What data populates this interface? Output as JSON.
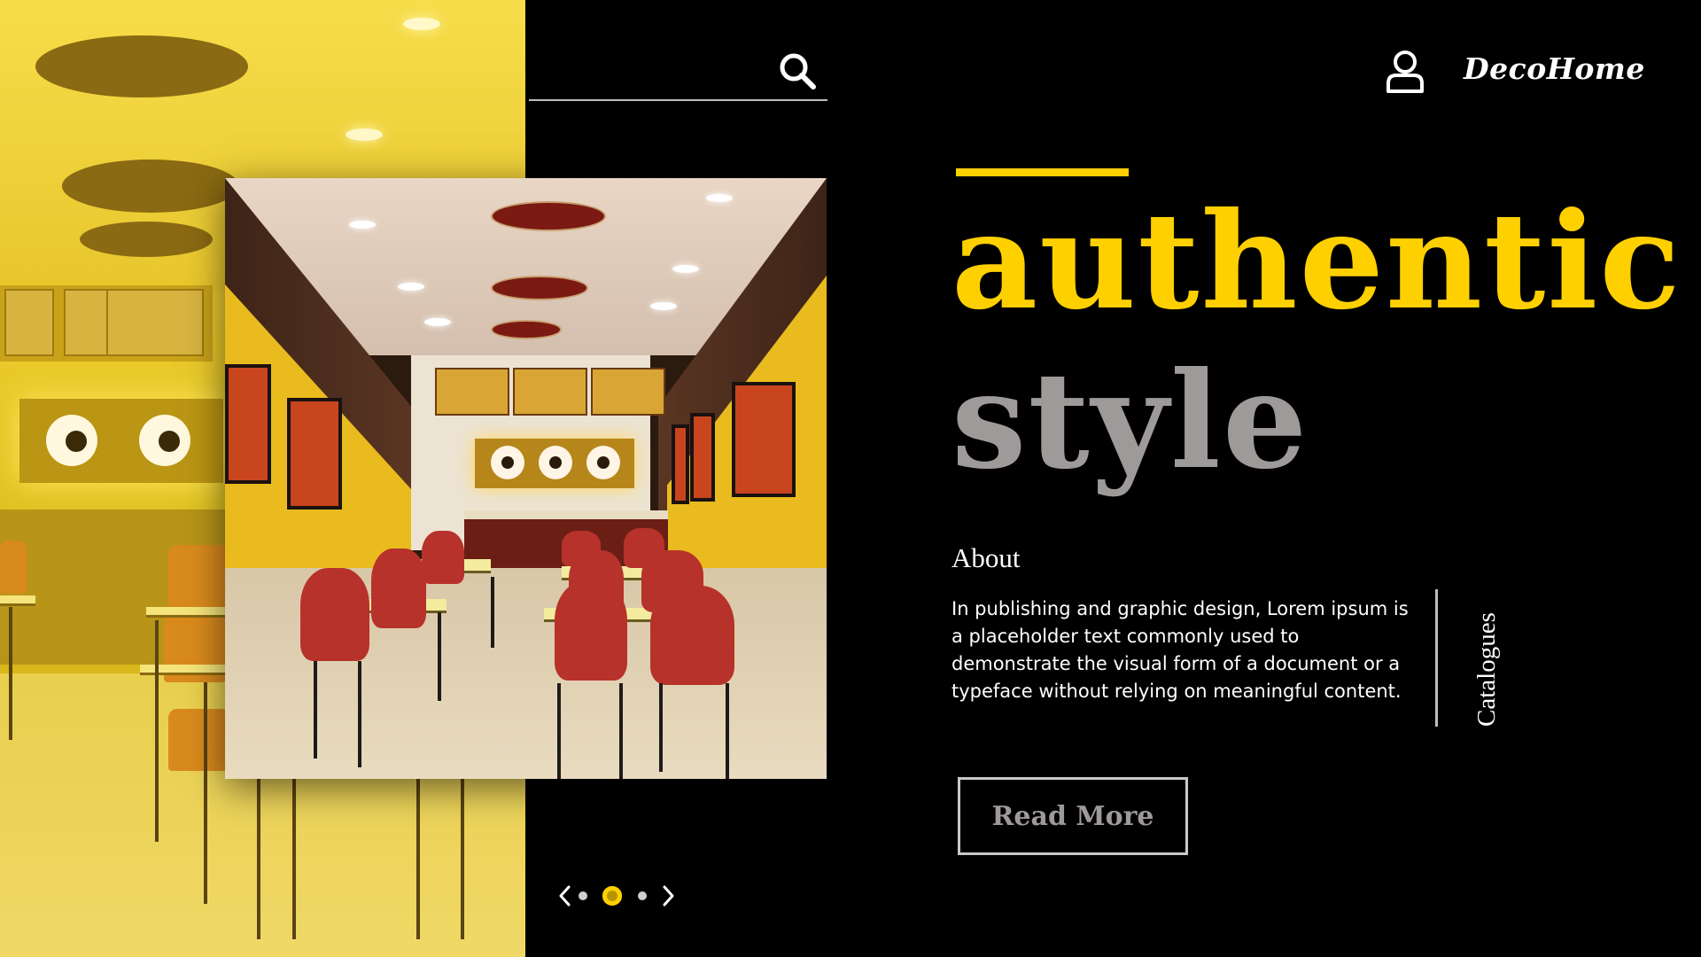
{
  "header": {
    "brand": "DecoHome",
    "search_icon": "search-icon",
    "user_icon": "user-icon"
  },
  "hero": {
    "headline_1": "authentic",
    "headline_2": "style",
    "accent_color": "#ffd000",
    "muted_color": "#9f9a9a"
  },
  "about": {
    "title": "About",
    "text": "In publishing and graphic design, Lorem ipsum is a placeholder text commonly used to demonstrate the visual form of a document or a typeface without relying on meaningful content."
  },
  "side_link": {
    "label": "Catalogues"
  },
  "cta": {
    "label": "Read More"
  },
  "pager": {
    "dots": 3,
    "active_index": 1
  }
}
